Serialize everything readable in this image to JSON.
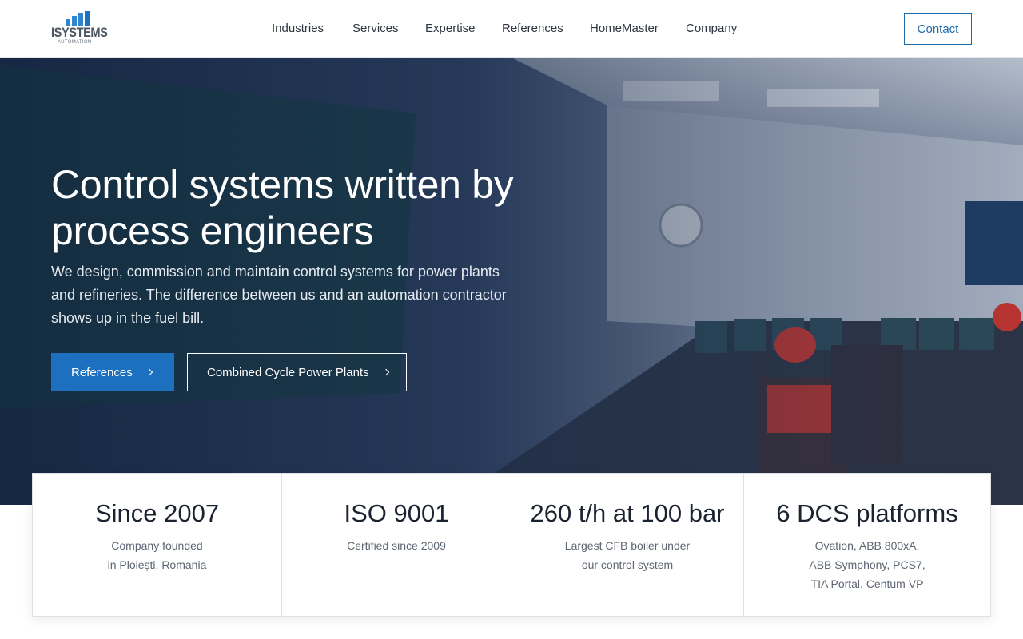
{
  "brand": {
    "name": "ISYSTEMS",
    "tagline": "AUTOMATION",
    "color_primary": "#1d6fbf",
    "color_dark": "#4c5560"
  },
  "nav": {
    "items": [
      "Industries",
      "Services",
      "Expertise",
      "References",
      "HomeMaster",
      "Company"
    ],
    "contact_label": "Contact"
  },
  "hero": {
    "title": "Control systems written by process engineers",
    "lead": "We design, commission and maintain control systems for power plants and refineries. The difference between us and an automation contractor shows up in the fuel bill.",
    "primary_button": "References",
    "secondary_button": "Combined Cycle Power Plants"
  },
  "stats": [
    {
      "value": "Since 2007",
      "desc": "Company founded\nin Ploiești, Romania"
    },
    {
      "value": "ISO 9001",
      "desc": "Certified since 2009"
    },
    {
      "value": "260 t/h at 100 bar",
      "desc": "Largest CFB boiler under\nour control system"
    },
    {
      "value": "6 DCS platforms",
      "desc": "Ovation, ABB 800xA,\nABB Symphony, PCS7,\nTIA Portal, Centum VP"
    }
  ]
}
